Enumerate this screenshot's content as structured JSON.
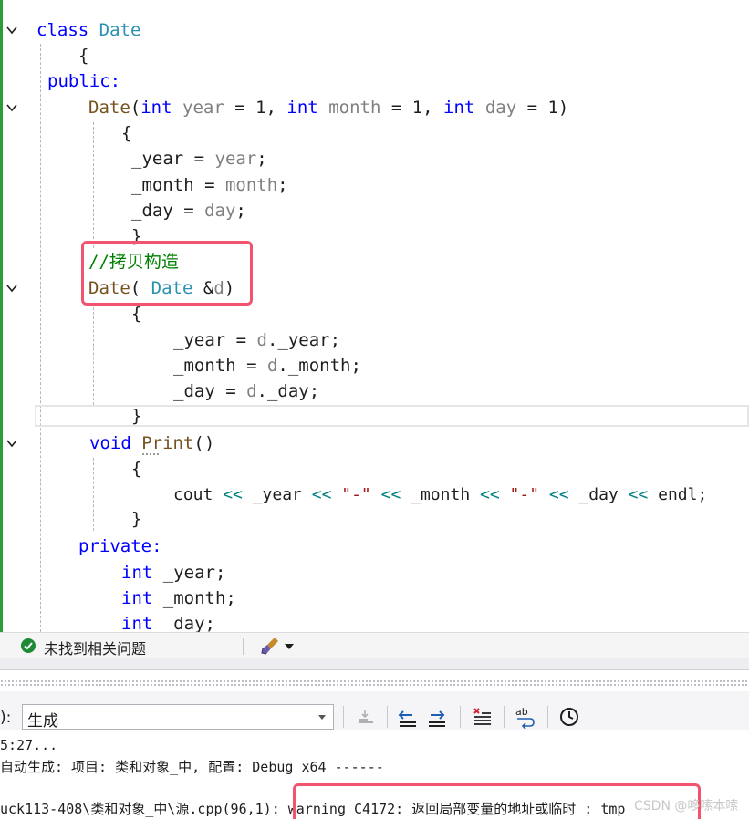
{
  "editor": {
    "lines": {
      "l1_kw": "class",
      "l1_name": "Date",
      "l2": "{",
      "l3": "public:",
      "l4_fn": "Date",
      "l4_p1": "(",
      "l4_int1": "int",
      "l4_year": "year",
      "l4_eq1": " = 1, ",
      "l4_int2": "int",
      "l4_month": "month",
      "l4_eq2": " = 1, ",
      "l4_int3": "int",
      "l4_day": "day",
      "l4_eq3": " = 1)",
      "l5": "{",
      "l6_a": "_year = ",
      "l6_b": "year",
      "l6_c": ";",
      "l7_a": "_month = ",
      "l7_b": "month",
      "l7_c": ";",
      "l8_a": "_day = ",
      "l8_b": "day",
      "l8_c": ";",
      "l9": "}",
      "l10": "//拷贝构造",
      "l11_fn": "Date",
      "l11_p": "( ",
      "l11_ty": "Date",
      "l11_amp": " &",
      "l11_d": "d",
      "l11_close": ")",
      "l12": "{",
      "l13_a": "_year = ",
      "l13_b": "d",
      "l13_c": "._year;",
      "l14_a": "_month = ",
      "l14_b": "d",
      "l14_c": "._month;",
      "l15_a": "_day = ",
      "l15_b": "d",
      "l15_c": "._day;",
      "l16": "}",
      "l17_kw": "void",
      "l17_fn": "Print",
      "l17_p": "()",
      "l18": "{",
      "l19_cout": "cout ",
      "l19_op1": "<<",
      "l19_y": " _year ",
      "l19_op2": "<<",
      "l19_s1": " \"-\" ",
      "l19_op3": "<<",
      "l19_m": " _month ",
      "l19_op4": "<<",
      "l19_s2": " \"-\" ",
      "l19_op5": "<<",
      "l19_d": " _day ",
      "l19_op6": "<<",
      "l19_endl": " endl;",
      "l20": "}",
      "l21": "private:",
      "l22_kw": "int",
      "l22_v": " _year;",
      "l23_kw": "int",
      "l23_v": " _month;",
      "l24_kw": "int",
      "l24_v": " _day;"
    }
  },
  "statusbar": {
    "status": "未找到相关问题"
  },
  "output": {
    "source_label": "):",
    "source_value": "生成",
    "lines": [
      "5:27...",
      "自动生成: 项目: 类和对象_中, 配置: Debug x64 ------",
      "uck113-408\\类和对象_中\\源.cpp(96,1): warning C4172: 返回局部变量的地址或临时 : tmp"
    ]
  },
  "watermark": "CSDN @哆嗦本嗦",
  "colors": {
    "keyword": "#0000ff",
    "type": "#2b91af",
    "comment": "#008000",
    "highlight_box": "#f25470",
    "status_ok": "#1e8a35"
  }
}
